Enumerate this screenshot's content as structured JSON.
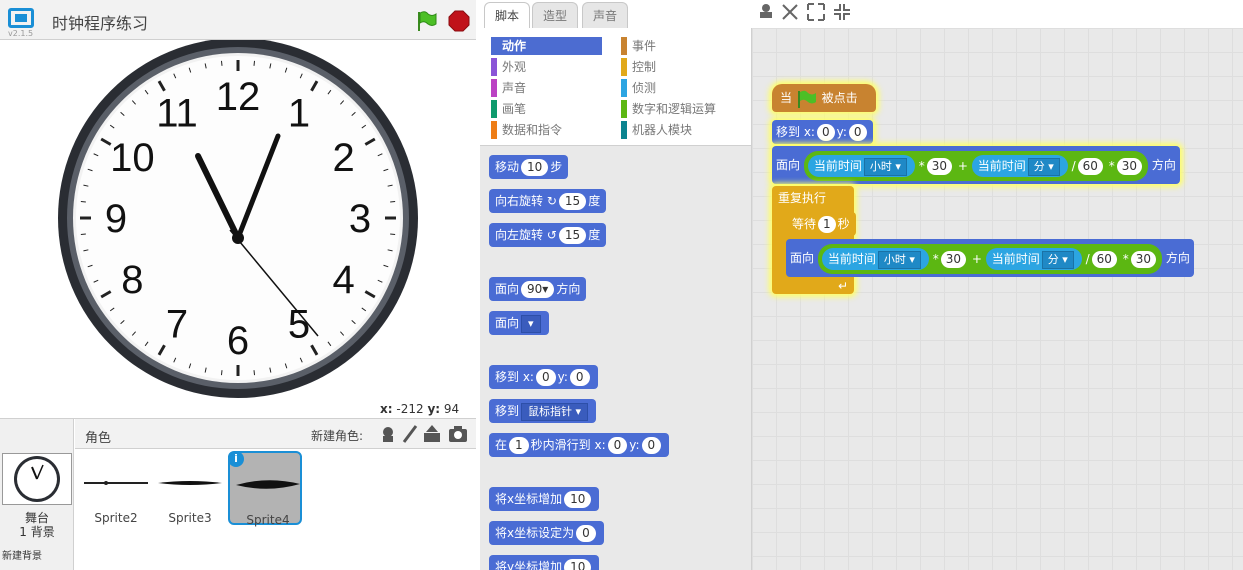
{
  "app": {
    "version": "v2.1.5",
    "project_title": "时钟程序练习"
  },
  "stage": {
    "mouse_x_label": "x:",
    "mouse_x": "-212",
    "mouse_y_label": "y:",
    "mouse_y": "94",
    "clock_numerals": [
      "12",
      "1",
      "2",
      "3",
      "4",
      "5",
      "6",
      "7",
      "8",
      "9",
      "10",
      "11"
    ]
  },
  "sprites": {
    "header": "角色",
    "new_sprite_label": "新建角色:",
    "stage_label": "舞台",
    "stage_backdrops": "1 背景",
    "new_backdrop": "新建背景",
    "items": [
      {
        "name": "Sprite2"
      },
      {
        "name": "Sprite3"
      },
      {
        "name": "Sprite4",
        "info": "i"
      }
    ]
  },
  "tabs": [
    {
      "label": "脚本"
    },
    {
      "label": "造型"
    },
    {
      "label": "声音"
    }
  ],
  "categories": [
    {
      "label": "动作",
      "color": "#4c6cd1"
    },
    {
      "label": "事件",
      "color": "#c88330"
    },
    {
      "label": "外观",
      "color": "#8a55d7"
    },
    {
      "label": "控制",
      "color": "#e1a91a"
    },
    {
      "label": "声音",
      "color": "#bb42c3"
    },
    {
      "label": "侦测",
      "color": "#2ca5e2"
    },
    {
      "label": "画笔",
      "color": "#0e9a6c"
    },
    {
      "label": "数字和逻辑运算",
      "color": "#5cb712"
    },
    {
      "label": "数据和指令",
      "color": "#ee7d16"
    },
    {
      "label": "机器人模块",
      "color": "#0b8490"
    }
  ],
  "palette": {
    "move": [
      "移动",
      "10",
      "步"
    ],
    "turn_right": [
      "向右旋转",
      "15",
      "度"
    ],
    "turn_left": [
      "向左旋转",
      "15",
      "度"
    ],
    "point_dir": [
      "面向",
      "90",
      "方向"
    ],
    "point_towards": [
      "面向",
      ""
    ],
    "goto_xy": [
      "移到 x:",
      "0",
      "y:",
      "0"
    ],
    "goto": [
      "移到",
      "鼠标指针"
    ],
    "glide": [
      "在",
      "1",
      "秒内滑行到 x:",
      "0",
      "y:",
      "0"
    ],
    "change_x": [
      "将x坐标增加",
      "10"
    ],
    "set_x": [
      "将x坐标设定为",
      "0"
    ],
    "change_y": [
      "将y坐标增加",
      "10"
    ]
  },
  "script": {
    "hat": [
      "当",
      "被点击"
    ],
    "goto": [
      "移到 x:",
      "0",
      "y:",
      "0"
    ],
    "point": {
      "label": "面向",
      "cur_time": "当前时间",
      "hour": "小时",
      "mul": "*",
      "thirty": "30",
      "plus": "+",
      "minute": "分",
      "div": "/",
      "sixty": "60",
      "dir": "方向"
    },
    "forever": "重复执行",
    "wait": [
      "等待",
      "1",
      "秒"
    ]
  },
  "colors": {
    "motion": "#4a6cd4",
    "events": "#c88330",
    "control": "#e1a91a",
    "sensing": "#2ca5e2",
    "operators": "#5cb712"
  }
}
